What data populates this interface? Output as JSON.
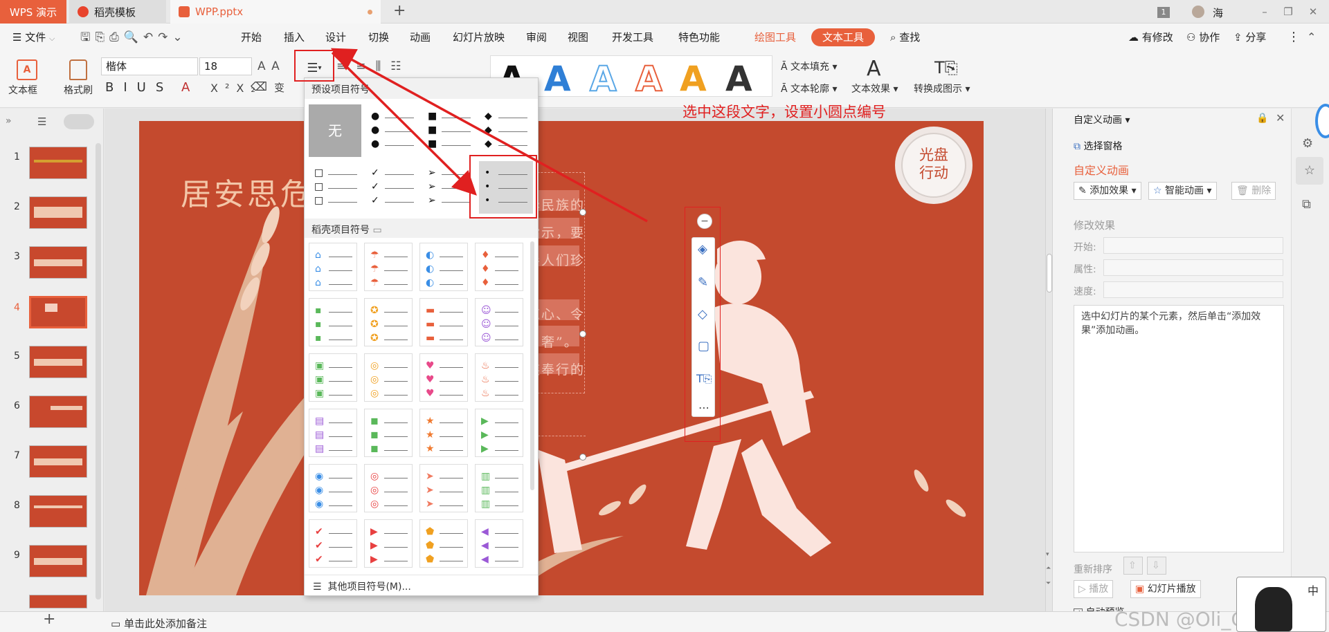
{
  "titlebar": {
    "tabs": [
      {
        "label": "WPS 演示"
      },
      {
        "label": "稻壳模板"
      },
      {
        "label": "WPP.pptx"
      }
    ],
    "add_tab": "+",
    "page_badge": "1",
    "user": "海"
  },
  "menubar": {
    "file": "文件",
    "items": [
      "开始",
      "插入",
      "设计",
      "切换",
      "动画",
      "幻灯片放映",
      "审阅",
      "视图",
      "开发工具",
      "特色功能"
    ],
    "drawing_tool": "绘图工具",
    "text_tool": "文本工具",
    "search": "查找",
    "right": [
      "有修改",
      "协作",
      "分享"
    ]
  },
  "toolbar": {
    "textbox": "文本框",
    "format_painter": "格式刷",
    "font_family": "楷体",
    "font_size": "18",
    "text_fill": "文本填充",
    "text_outline": "文本轮廓",
    "text_effect": "文本效果",
    "convert_smartart": "转换成图示",
    "art_colors": [
      "#111111",
      "#2f7fd6",
      "#5aa7e6",
      "#e8603c",
      "#f0a020",
      "#333333"
    ]
  },
  "dropdown": {
    "preset_title": "预设项目符号",
    "none_label": "无",
    "daoke_title": "稻壳项目符号",
    "more": "其他项目符号(M)..."
  },
  "annotation": {
    "text": "选中这段文字，设置小圆点编号",
    "color": "#e02020"
  },
  "slide": {
    "title": "居安思危",
    "badge_line1": "光盘",
    "badge_line2": "行动",
    "text_lines": [
      "约，是中华民族的",
      "做出重要指示，要",
      "上也曾倡导人们珍",
      "依然触目惊心、令",
      "由勤俭败由奢”。",
      "是中华民族奉行的"
    ],
    "bg": "#c44a2e"
  },
  "thumbnails": [
    "1",
    "2",
    "3",
    "4",
    "5",
    "6",
    "7",
    "8",
    "9"
  ],
  "rightpanel": {
    "header": "自定义动画",
    "select_pane": "选择窗格",
    "section": "自定义动画",
    "add_effect": "添加效果",
    "smart_anim": "智能动画",
    "delete": "删除",
    "modify": "修改效果",
    "start": "开始:",
    "property": "属性:",
    "speed": "速度:",
    "hint": "选中幻灯片的某个元素，然后单击“添加效果”添加动画。",
    "reorder": "重新排序",
    "play": "播放",
    "slideshow": "幻灯片播放",
    "autopreview": "自动预览"
  },
  "statusbar": {
    "notes": "单击此处添加备注",
    "watermark": "CSDN @Oli_Correct",
    "ime": "中"
  }
}
